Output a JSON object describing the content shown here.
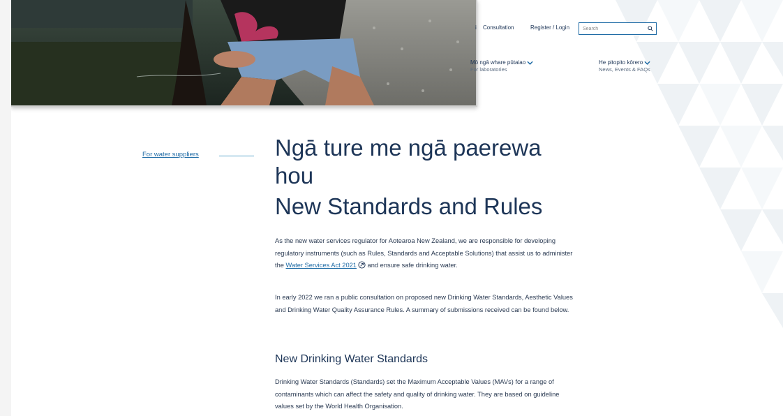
{
  "nav": {
    "partial_link": "i",
    "consultation": "Consultation",
    "register_login": "Register / Login",
    "search_placeholder": "Search"
  },
  "menu": {
    "labs_mi": "Mō ngā whare pūtaiao",
    "labs_en": "For laboratories",
    "news_mi": "He pitopito kōrero",
    "news_en": "News, Events & FAQs"
  },
  "sidebar": {
    "link": "For water suppliers"
  },
  "page": {
    "title_mi": "Ngā ture me ngā paerewa hou",
    "title_en": "New Standards and Rules",
    "p1_a": "As the new water services regulator for Aotearoa New Zealand, we are responsible for developing regulatory instruments (such as Rules, Standards and Acceptable Solutions) that assist us to administer the ",
    "p1_link": "Water Services Act 2021",
    "p1_b": " and ensure safe drinking water.",
    "p2": "In early 2022 we ran a public consultation on proposed new Drinking Water Standards, Aesthetic Values and Drinking Water Quality Assurance Rules. A summary of submissions received can be found below.",
    "h2": "New Drinking Water Standards",
    "p3": "Drinking Water Standards (Standards) set the Maximum Acceptable Values (MAVs) for a range of contaminants which can affect the safety and quality of drinking water. They are based on guideline values set by the World Health Organisation."
  },
  "colors": {
    "navy": "#1d3557",
    "link": "#1d6aa5",
    "accent_line": "#5aa6c9"
  }
}
